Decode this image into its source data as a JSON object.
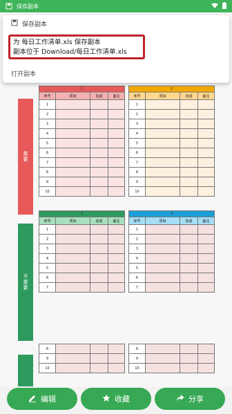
{
  "status_bar": {
    "title": "保存副本"
  },
  "notification": {
    "header": "保存副本",
    "line1": "为 每日工作清单.xls 保存副本",
    "line2": "副本位于 Download/每日工作清单.xls",
    "action": "打开副本"
  },
  "quadrants": [
    {
      "id": "q1",
      "group_label": "重要",
      "title": "1",
      "color": "#e85a5a",
      "header_color": "#f4b1b1",
      "row_color": "#fbe3e3"
    },
    {
      "id": "q2",
      "group_label": "",
      "title": "2",
      "color": "#f2a900",
      "header_color": "#ffd890",
      "row_color": "#fdf0de"
    },
    {
      "id": "q3",
      "group_label": "不重要",
      "title": "3",
      "color": "#2e9a5e",
      "header_color": "#a8e0bd",
      "row_color": "#f6e1e1"
    },
    {
      "id": "q4",
      "group_label": "",
      "title": "4",
      "color": "#1b9ed6",
      "header_color": "#a6def5",
      "row_color": "#f6e1e1"
    }
  ],
  "columns": [
    "序号",
    "项目",
    "完成",
    "备注"
  ],
  "upper_rows": [
    "1",
    "2",
    "3",
    "4",
    "5",
    "6",
    "7",
    "8",
    "9",
    "10"
  ],
  "lower_rows": [
    "1",
    "2",
    "3",
    "4",
    "5",
    "6",
    "7"
  ],
  "bottom_rows": [
    "8",
    "9",
    "10"
  ],
  "actions": {
    "edit": "编辑",
    "favorite": "收藏",
    "share": "分享"
  },
  "colors": {
    "accent": "#37a854",
    "status_bar": "#3fb45a",
    "highlight_border": "#c0222a"
  }
}
